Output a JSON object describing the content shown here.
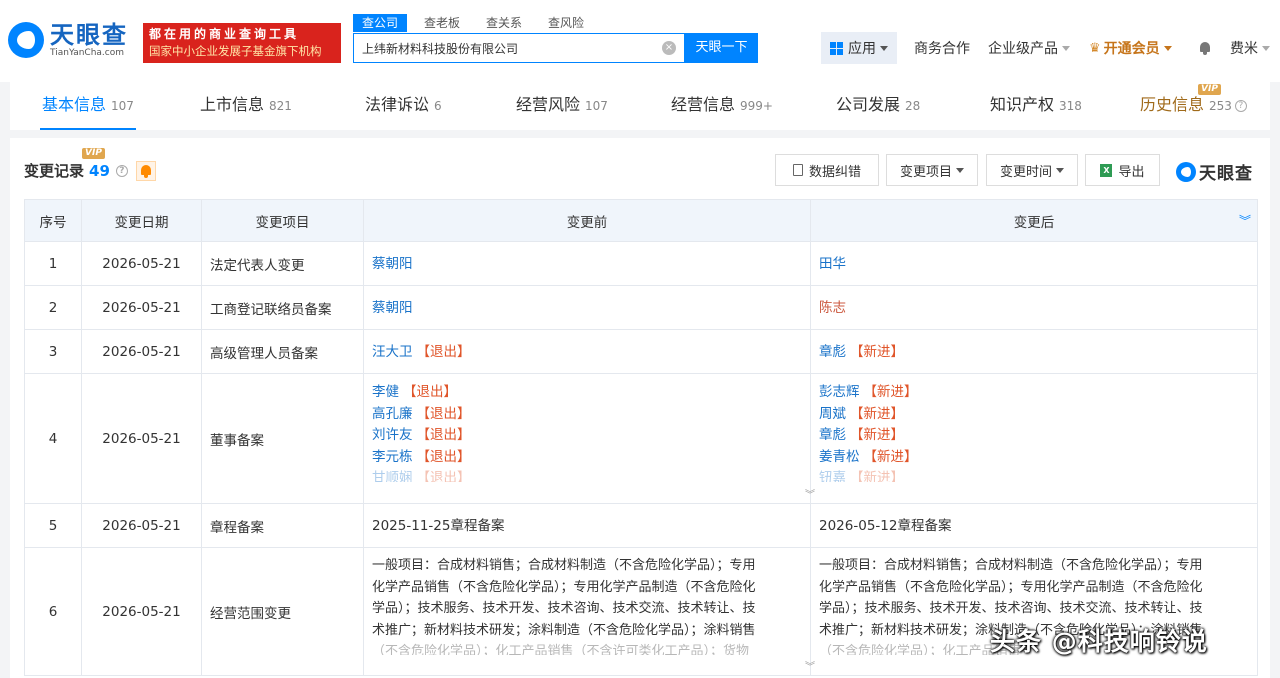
{
  "header": {
    "logo_cn": "天眼查",
    "logo_en": "TianYanCha.com",
    "banner_line1": "都在用的商业查询工具",
    "banner_line2": "国家中小企业发展子基金旗下机构",
    "search_tabs": [
      "查公司",
      "查老板",
      "查关系",
      "查风险"
    ],
    "search_value": "上纬新材料科技股份有限公司",
    "search_button": "天眼一下",
    "app_label": "应用",
    "business": "商务合作",
    "enterprise": "企业级产品",
    "vip": "开通会员",
    "user": "费米"
  },
  "tabs": [
    {
      "label": "基本信息",
      "count": "107"
    },
    {
      "label": "上市信息",
      "count": "821"
    },
    {
      "label": "法律诉讼",
      "count": "6"
    },
    {
      "label": "经营风险",
      "count": "107"
    },
    {
      "label": "经营信息",
      "count": "999+"
    },
    {
      "label": "公司发展",
      "count": "28"
    },
    {
      "label": "知识产权",
      "count": "318"
    },
    {
      "label": "历史信息",
      "count": "253"
    }
  ],
  "vip_badge": "VIP",
  "section": {
    "title": "变更记录",
    "count": "49",
    "buttons": {
      "correct": "数据纠错",
      "item": "变更项目",
      "time": "变更时间",
      "export": "导出"
    },
    "brand": "天眼查"
  },
  "table": {
    "headers": [
      "序号",
      "变更日期",
      "变更项目",
      "变更前",
      "变更后"
    ],
    "rows": [
      {
        "no": "1",
        "date": "2026-05-21",
        "item": "法定代表人变更",
        "before": "蔡朝阳",
        "after": "田华"
      },
      {
        "no": "2",
        "date": "2026-05-21",
        "item": "工商登记联络员备案",
        "before": "蔡朝阳",
        "after": "陈志"
      },
      {
        "no": "3",
        "date": "2026-05-21",
        "item": "高级管理人员备案",
        "before_name": "汪大卫",
        "before_tag": "【退出】",
        "after_name": "章彪",
        "after_tag": "【新进】"
      },
      {
        "no": "4",
        "date": "2026-05-21",
        "item": "董事备案",
        "before": [
          {
            "name": "李健",
            "tag": "【退出】"
          },
          {
            "name": "高孔廉",
            "tag": "【退出】"
          },
          {
            "name": "刘许友",
            "tag": "【退出】"
          },
          {
            "name": "李元栋",
            "tag": "【退出】"
          },
          {
            "name": "甘顺娴",
            "tag": "【退出】"
          }
        ],
        "after": [
          {
            "name": "彭志辉",
            "tag": "【新进】"
          },
          {
            "name": "周斌",
            "tag": "【新进】"
          },
          {
            "name": "章彪",
            "tag": "【新进】"
          },
          {
            "name": "姜青松",
            "tag": "【新进】"
          },
          {
            "name": "钮嘉",
            "tag": "【新进】"
          }
        ]
      },
      {
        "no": "5",
        "date": "2026-05-21",
        "item": "章程备案",
        "before": "2025-11-25章程备案",
        "after": "2026-05-12章程备案"
      },
      {
        "no": "6",
        "date": "2026-05-21",
        "item": "经营范围变更",
        "before": [
          "一般项目：合成材料销售；合成材料制造（不含危险化学品）；专用",
          "化学产品销售（不含危险化学品）；专用化学产品制造（不含危险化",
          "学品）；技术服务、技术开发、技术咨询、技术交流、技术转让、技",
          "术推广；新材料技术研发；涂料制造（不含危险化学品）；涂料销售",
          "（不含危险化学品）；化工产品销售（不含许可类化工产品）；货物"
        ],
        "after": [
          "一般项目：合成材料销售；合成材料制造（不含危险化学品）；专用",
          "化学产品销售（不含危险化学品）；专用化学产品制造（不含危险化",
          "学品）；技术服务、技术开发、技术咨询、技术交流、技术转让、技",
          "术推广；新材料技术研发；涂料制造（不含危险化学品）；涂料销售",
          "（不含危险化学品）；化工产品销售"
        ]
      }
    ]
  },
  "watermark": "头条 @科技响铃说"
}
